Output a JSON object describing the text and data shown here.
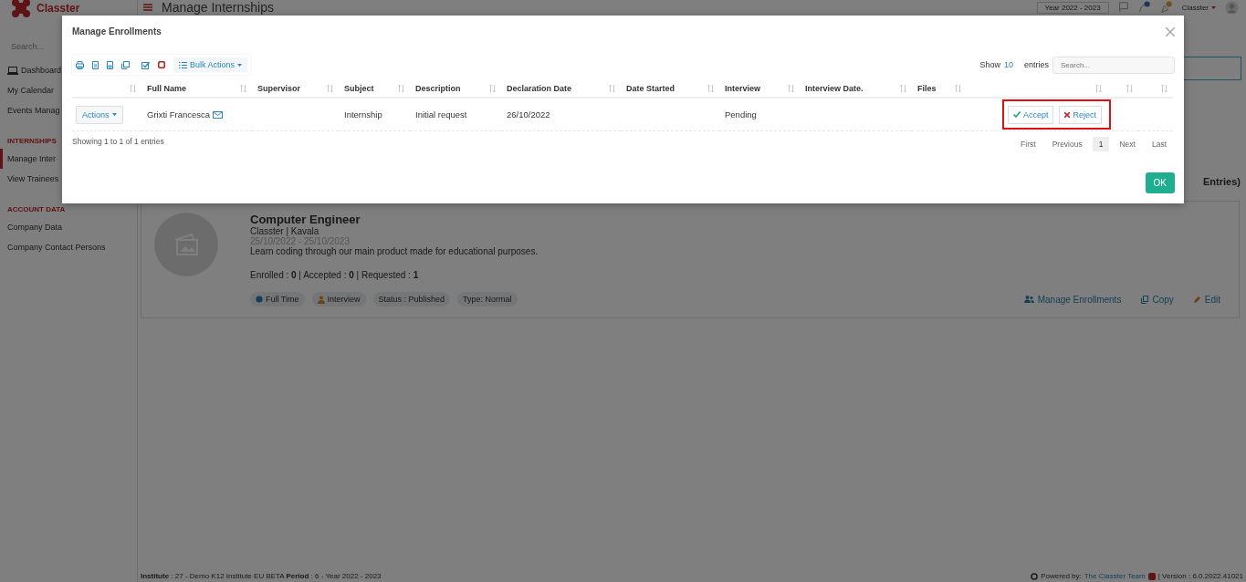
{
  "header": {
    "logo": "Classter",
    "title": "Manage Internships",
    "year": "Year 2022 - 2023",
    "user": "Classter"
  },
  "sidebar": {
    "search_placeholder": "Search...",
    "items": [
      {
        "kind": "icon_item",
        "label": "Dashboard",
        "selected": false
      },
      {
        "kind": "item",
        "label": "My Calendar",
        "selected": false
      },
      {
        "kind": "item",
        "label": "Events Manag",
        "selected": false
      },
      {
        "kind": "section",
        "label": "INTERNSHIPS"
      },
      {
        "kind": "item",
        "label": "Manage Inter",
        "selected": true
      },
      {
        "kind": "item",
        "label": "View Trainees",
        "selected": false
      },
      {
        "kind": "section",
        "label": "ACCOUNT DATA"
      },
      {
        "kind": "item",
        "label": "Company Data",
        "selected": false
      },
      {
        "kind": "item",
        "label": "Company Contact Persons",
        "selected": false
      }
    ]
  },
  "page": {
    "entries_count": "Entries)",
    "card": {
      "title": "Computer Engineer",
      "company": "Classter | Kavala",
      "dates": "25/10/2022 - 25/10/2023",
      "description": "Learn coding through our main product made for educational purposes.",
      "stats": "Enrolled : **0** | Accepted : **0** | Requested : **1**",
      "tags": [
        {
          "kind": "globe",
          "label": "Full Time"
        },
        {
          "kind": "person",
          "label": "Interview"
        },
        {
          "kind": "plain",
          "label": "Status : Published"
        },
        {
          "kind": "plain",
          "label": "Type: Normal"
        }
      ],
      "actions": [
        {
          "kind": "users",
          "label": "Manage Enrollments"
        },
        {
          "kind": "copy",
          "label": "Copy"
        },
        {
          "kind": "edit",
          "label": "Edit"
        }
      ]
    }
  },
  "modal": {
    "title": "Manage Enrollments",
    "bulk_actions": "Bulk Actions",
    "show": "Show",
    "page_size": "10",
    "entries": "entries",
    "search_placeholder": "Search...",
    "columns": [
      "Full Name",
      "Supervisor",
      "Subject",
      "Description",
      "Declaration Date",
      "Date Started",
      "Interview",
      "Interview Date.",
      "Files"
    ],
    "rows": [
      {
        "actions": "Actions",
        "full_name": "Grixti Francesca",
        "subject": "Internship",
        "description": "Initial request",
        "declaration_date": "26/10/2022",
        "interview": "Pending",
        "accept": "Accept",
        "reject": "Reject"
      }
    ],
    "info": "Showing 1 to 1 of 1 entries",
    "pagination": [
      {
        "label": "First",
        "selected": false
      },
      {
        "label": "Previous",
        "selected": false
      },
      {
        "label": "1",
        "selected": true
      },
      {
        "label": "Next",
        "selected": false
      },
      {
        "label": "Last",
        "selected": false
      }
    ],
    "ok": "OK"
  },
  "footer": {
    "left": "**Institute** : 27 - Demo K12 Institute EU BETA **Period** : 6 - Year 2022 - 2023",
    "powered": "Powered by:",
    "team": "The Classter Team",
    "version": "| Version : 6.0.2022.41021"
  }
}
